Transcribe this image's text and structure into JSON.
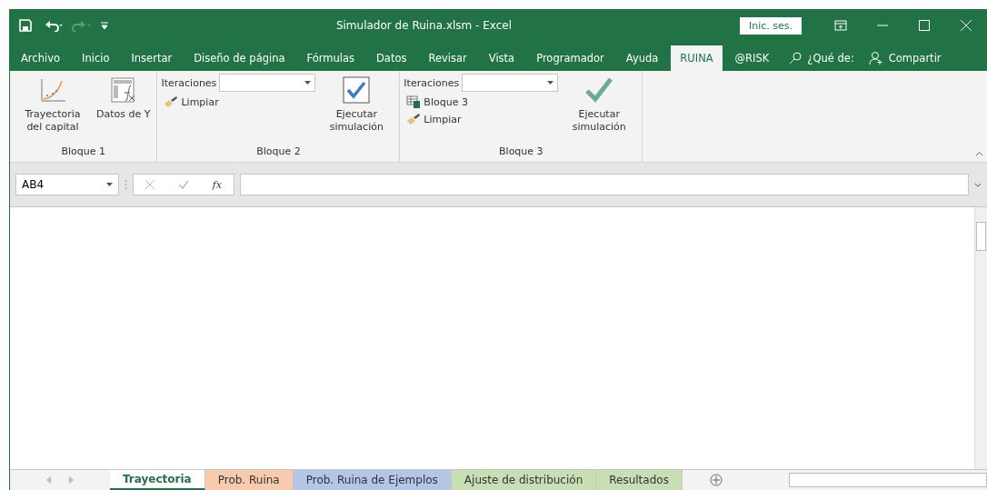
{
  "window": {
    "title": "Simulador de Ruina.xlsm  -  Excel",
    "sign_in": "Inic. ses."
  },
  "menu_tabs": [
    {
      "label": "Archivo",
      "selected": false
    },
    {
      "label": "Inicio",
      "selected": false
    },
    {
      "label": "Insertar",
      "selected": false
    },
    {
      "label": "Diseño de página",
      "selected": false
    },
    {
      "label": "Fórmulas",
      "selected": false
    },
    {
      "label": "Datos",
      "selected": false
    },
    {
      "label": "Revisar",
      "selected": false
    },
    {
      "label": "Vista",
      "selected": false
    },
    {
      "label": "Programador",
      "selected": false
    },
    {
      "label": "Ayuda",
      "selected": false
    },
    {
      "label": "RUINA",
      "selected": true
    },
    {
      "label": "@RISK",
      "selected": false
    }
  ],
  "tell_me": "¿Qué de:",
  "share": "Compartir",
  "ribbon_groups": [
    {
      "label": "Bloque 1",
      "items": [
        {
          "kind": "chart",
          "label": "Trayectoria del capital"
        },
        {
          "kind": "function",
          "label": "Datos de Y"
        }
      ]
    },
    {
      "label": "Bloque 2",
      "items": [
        {
          "kind": "stack",
          "rows": [
            {
              "kind": "dropdown",
              "label": "Iteraciones"
            },
            {
              "kind": "brush",
              "label": "Limpiar"
            }
          ]
        },
        {
          "kind": "checkbox",
          "label": "Ejecutar simulación"
        }
      ]
    },
    {
      "label": "Bloque 3",
      "items": [
        {
          "kind": "stack",
          "rows": [
            {
              "kind": "dropdown",
              "label": "Iteraciones"
            },
            {
              "kind": "sheet",
              "label": "Bloque 3"
            },
            {
              "kind": "brush",
              "label": "Limpiar"
            }
          ]
        },
        {
          "kind": "check",
          "label": "Ejecutar simulación"
        }
      ]
    }
  ],
  "formula_bar": {
    "name_box": "AB4",
    "fx": "fx"
  },
  "sheet_tabs": [
    {
      "label": "Trayectoria",
      "selected": true,
      "color": "#ffffff"
    },
    {
      "label": "Prob. Ruina",
      "selected": false,
      "color": "#f8cbad"
    },
    {
      "label": "Prob. Ruina de Ejemplos",
      "selected": false,
      "color": "#b4c6e7"
    },
    {
      "label": "Ajuste de distribución",
      "selected": false,
      "color": "#c6e0b4"
    },
    {
      "label": "Resultados",
      "selected": false,
      "color": "#c6e0b4"
    }
  ]
}
